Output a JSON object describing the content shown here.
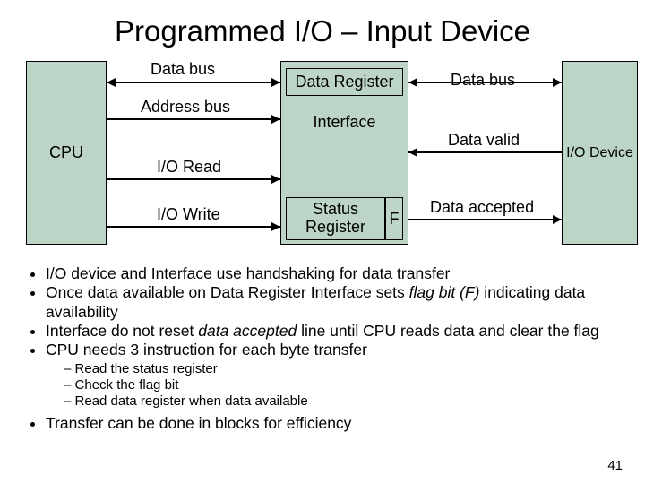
{
  "title": "Programmed I/O – Input Device",
  "diagram": {
    "cpu": "CPU",
    "interface": "Interface",
    "iodevice": "I/O Device",
    "data_register": "Data Register",
    "status_register": "Status\nRegister",
    "flag": "F",
    "labels": {
      "data_bus_left": "Data bus",
      "address_bus": "Address bus",
      "io_read": "I/O Read",
      "io_write": "I/O Write",
      "data_bus_right": "Data bus",
      "data_valid": "Data valid",
      "data_accepted": "Data accepted"
    }
  },
  "bullets": {
    "b1": "I/O device and Interface use handshaking for data transfer",
    "b2a": "Once data available on Data Register Interface sets ",
    "b2b": "flag bit (F)",
    "b2c": " indicating data availability",
    "b3a": "Interface do not reset ",
    "b3b": "data accepted",
    "b3c": " line until CPU reads data and clear the flag",
    "b4": "CPU needs 3 instruction for each byte transfer",
    "s1": "Read the status register",
    "s2": "Check the flag bit",
    "s3": "Read data register when data available",
    "b5": "Transfer can be done in blocks for efficiency"
  },
  "page_number": "41"
}
